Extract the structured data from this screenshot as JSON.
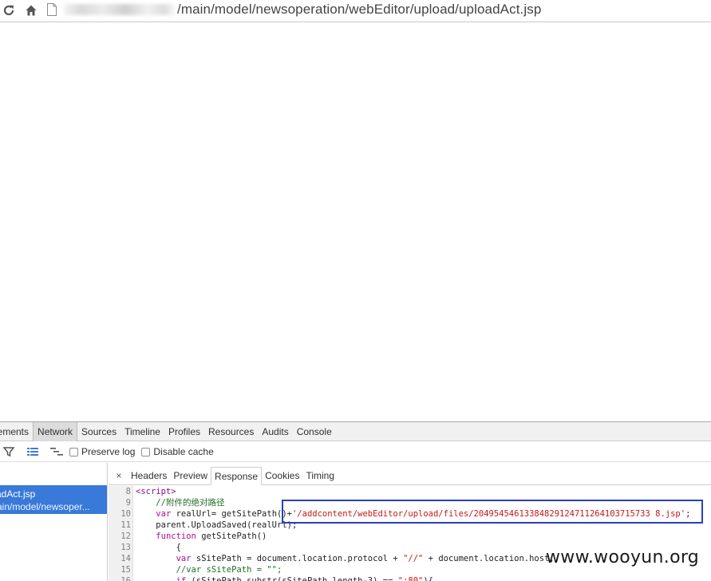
{
  "browser": {
    "url_path": "/main/model/newsoperation/webEditor/upload/uploadAct.jsp",
    "icons": {
      "reload": "reload-icon",
      "home": "home-icon",
      "page": "page-icon"
    }
  },
  "devtools": {
    "panel_tabs": [
      "lements",
      "Network",
      "Sources",
      "Timeline",
      "Profiles",
      "Resources",
      "Audits",
      "Console"
    ],
    "active_panel": "Network",
    "toolbar": {
      "preserve_log_label": "Preserve log",
      "disable_cache_label": "Disable cache",
      "preserve_log_checked": false,
      "disable_cache_checked": false
    },
    "requests": [
      {
        "name": "adAct.jsp",
        "path": "ain/model/newsoper..."
      }
    ],
    "detail_tabs": [
      "Headers",
      "Preview",
      "Response",
      "Cookies",
      "Timing"
    ],
    "active_detail_tab": "Response",
    "close_label": "×",
    "code_lines": [
      {
        "num": "8",
        "parts": [
          [
            "tag",
            "<script>"
          ]
        ]
      },
      {
        "num": "9",
        "parts": [
          [
            "txt",
            "    "
          ],
          [
            "cm",
            "//附件的绝对路径"
          ]
        ]
      },
      {
        "num": "10",
        "parts": [
          [
            "txt",
            "    "
          ],
          [
            "kw",
            "var"
          ],
          [
            "txt",
            " realUrl= getSitePath()+"
          ],
          [
            "str",
            "'/addcontent/webEditor/upload/files/20495454613384829124711264103715733 8.jsp'"
          ],
          [
            "txt",
            ";"
          ]
        ]
      },
      {
        "num": "11",
        "parts": [
          [
            "txt",
            "    parent.UploadSaved(realUrl);"
          ]
        ]
      },
      {
        "num": "12",
        "parts": [
          [
            "txt",
            "    "
          ],
          [
            "kw",
            "function"
          ],
          [
            "txt",
            " getSitePath()"
          ]
        ]
      },
      {
        "num": "13",
        "parts": [
          [
            "txt",
            "        {"
          ]
        ]
      },
      {
        "num": "14",
        "parts": [
          [
            "txt",
            "        "
          ],
          [
            "kw",
            "var"
          ],
          [
            "txt",
            " sSitePath = document.location.protocol + "
          ],
          [
            "str",
            "\"//\""
          ],
          [
            "txt",
            " + document.location.host;"
          ]
        ]
      },
      {
        "num": "15",
        "parts": [
          [
            "txt",
            "        "
          ],
          [
            "cm",
            "//var sSitePath = \"\";"
          ]
        ]
      },
      {
        "num": "16",
        "parts": [
          [
            "txt",
            "        "
          ],
          [
            "kw",
            "if"
          ],
          [
            "txt",
            " (sSitePath.substr(sSitePath.length-3) == "
          ],
          [
            "str",
            "\":80\""
          ],
          [
            "txt",
            "){"
          ]
        ]
      }
    ]
  },
  "watermark": "www.wooyun.org",
  "colors": {
    "selected_request": "#3879d9",
    "highlight_box": "#2a3fb8",
    "comment": "#236e25",
    "string": "#c41a16",
    "keyword": "#aa0d91",
    "tag": "#881280"
  }
}
